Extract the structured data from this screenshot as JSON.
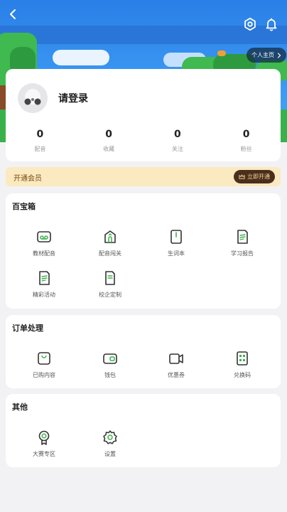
{
  "header": {
    "profile_link_label": "个人主页"
  },
  "user": {
    "login_label": "请登录",
    "stats": [
      {
        "value": "0",
        "label": "配音"
      },
      {
        "value": "0",
        "label": "收藏"
      },
      {
        "value": "0",
        "label": "关注"
      },
      {
        "value": "0",
        "label": "粉丝"
      }
    ]
  },
  "vip": {
    "title": "开通会员",
    "button_label": "立即开通"
  },
  "treasure_box": {
    "title": "百宝箱",
    "items": [
      {
        "label": "教材配音",
        "icon": "voicemail-icon"
      },
      {
        "label": "配音闯关",
        "icon": "house-level-icon"
      },
      {
        "label": "生词本",
        "icon": "notebook-icon"
      },
      {
        "label": "学习报告",
        "icon": "report-icon"
      },
      {
        "label": "精彩活动",
        "icon": "activity-icon"
      },
      {
        "label": "校企定制",
        "icon": "custom-icon"
      }
    ]
  },
  "orders": {
    "title": "订单处理",
    "items": [
      {
        "label": "已购内容",
        "icon": "purchased-bag-icon"
      },
      {
        "label": "钱包",
        "icon": "wallet-icon"
      },
      {
        "label": "优惠券",
        "icon": "coupon-icon"
      },
      {
        "label": "兑换码",
        "icon": "redeem-code-icon"
      }
    ]
  },
  "other": {
    "title": "其他",
    "items": [
      {
        "label": "大赛专区",
        "icon": "medal-icon"
      },
      {
        "label": "设置",
        "icon": "settings-icon"
      }
    ]
  },
  "colors": {
    "accent_green": "#3cb34a",
    "vip_bg": "#fbe9c0",
    "vip_button": "#4a2f1c"
  }
}
